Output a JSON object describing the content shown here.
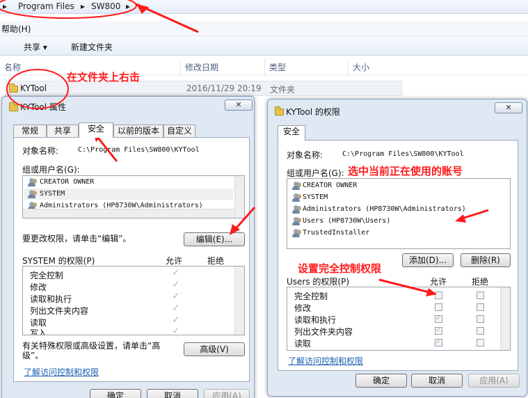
{
  "explorer": {
    "breadcrumb": [
      "Program Files",
      "SW800"
    ],
    "menu_help": "帮助(H)",
    "toolbar_share": "共享 ▾",
    "toolbar_newfolder": "新建文件夹",
    "columns": [
      "名称",
      "修改日期",
      "类型",
      "大小"
    ],
    "file": {
      "name": "KYTool",
      "date": "2016/11/29 20:19",
      "type": "文件夹"
    }
  },
  "annotations": {
    "right_click": "在文件夹上右击",
    "select_account": "选中当前正在使用的账号",
    "set_full_control": "设置完全控制权限"
  },
  "props_dialog": {
    "title": "KYTool 属性",
    "close": "✕",
    "tabs": [
      "常规",
      "共享",
      "安全",
      "以前的版本",
      "自定义"
    ],
    "object_label": "对象名称:",
    "object_value": "C:\\Program Files\\SW800\\KYTool",
    "group_label": "组或用户名(G):",
    "users": [
      "CREATOR OWNER",
      "SYSTEM",
      "Administrators (HP8730W\\Administrators)"
    ],
    "change_hint": "要更改权限，请单击“编辑”。",
    "edit_button": "编辑(E)...",
    "perm_label": "SYSTEM 的权限(P)",
    "allow": "允许",
    "deny": "拒绝",
    "permissions": [
      "完全控制",
      "修改",
      "读取和执行",
      "列出文件夹内容",
      "读取",
      "写入"
    ],
    "special_hint": "有关特殊权限或高级设置，请单击“高级”。",
    "advanced_button": "高级(V)",
    "learn_link": "了解访问控制和权限",
    "ok": "确定",
    "cancel": "取消",
    "apply": "应用(A)"
  },
  "perm_dialog": {
    "title": "KYTool 的权限",
    "close": "✕",
    "tab": "安全",
    "object_label": "对象名称:",
    "object_value": "C:\\Program Files\\SW800\\KYTool",
    "group_label": "组或用户名(G):",
    "users": [
      "CREATOR OWNER",
      "SYSTEM",
      "Administrators (HP8730W\\Administrators)",
      "Users (HP8730W\\Users)",
      "TrustedInstaller"
    ],
    "add_button": "添加(D)...",
    "remove_button": "删除(R)",
    "perm_label": "Users 的权限(P)",
    "allow": "允许",
    "deny": "拒绝",
    "permissions": [
      "完全控制",
      "修改",
      "读取和执行",
      "列出文件夹内容",
      "读取"
    ],
    "learn_link": "了解访问控制和权限",
    "ok": "确定",
    "cancel": "取消",
    "apply": "应用(A)"
  },
  "colors": {
    "annotation_red": "#ff1a1a",
    "link_blue": "#1a5fb4"
  }
}
